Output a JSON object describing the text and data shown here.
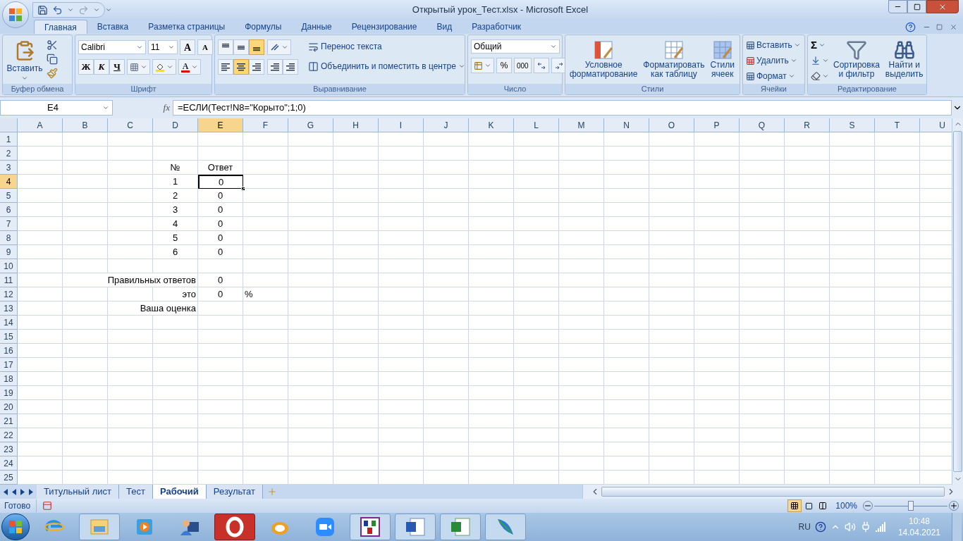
{
  "window": {
    "title": "Открытый урок_Тест.xlsx - Microsoft Excel"
  },
  "ribbon_tabs": [
    {
      "label": "Главная",
      "selected": true
    },
    {
      "label": "Вставка",
      "selected": false
    },
    {
      "label": "Разметка страницы",
      "selected": false
    },
    {
      "label": "Формулы",
      "selected": false
    },
    {
      "label": "Данные",
      "selected": false
    },
    {
      "label": "Рецензирование",
      "selected": false
    },
    {
      "label": "Вид",
      "selected": false
    },
    {
      "label": "Разработчик",
      "selected": false
    }
  ],
  "clipboard": {
    "title": "Буфер обмена",
    "paste": "Вставить"
  },
  "font": {
    "title": "Шрифт",
    "name": "Calibri",
    "size": "11",
    "grow": "A",
    "shrink": "A",
    "bold": "Ж",
    "italic": "К",
    "underline": "Ч",
    "color_letter": "A"
  },
  "alignment": {
    "title": "Выравнивание",
    "vertical": [
      {
        "selected": false
      },
      {
        "selected": false
      },
      {
        "selected": true
      }
    ],
    "horizontal": [
      {
        "selected": false
      },
      {
        "selected": true
      },
      {
        "selected": false
      }
    ],
    "wrap": "Перенос текста",
    "merge": "Объединить и поместить в центре"
  },
  "number": {
    "title": "Число",
    "format": "Общий",
    "percent": "%",
    "thousands": "000"
  },
  "styles": {
    "title": "Стили",
    "buttons": [
      {
        "lines": [
          "Условное",
          "форматирование"
        ]
      },
      {
        "lines": [
          "Форматировать",
          "как таблицу"
        ]
      },
      {
        "lines": [
          "Стили",
          "ячеек"
        ]
      }
    ]
  },
  "cells": {
    "title": "Ячейки",
    "buttons": [
      "Вставить",
      "Удалить",
      "Формат"
    ]
  },
  "editing": {
    "title": "Редактирование",
    "sigma": "Σ",
    "buttons": [
      {
        "lines": [
          "Сортировка",
          "и фильтр"
        ]
      },
      {
        "lines": [
          "Найти и",
          "выделить"
        ]
      }
    ]
  },
  "formula_bar": {
    "name_box": "E4",
    "fx": "fx",
    "formula": "=ЕСЛИ(Тест!N8=\"Корыто\";1;0)"
  },
  "columns": [
    "A",
    "B",
    "C",
    "D",
    "E",
    "F",
    "G",
    "H",
    "I",
    "J",
    "K",
    "L",
    "M",
    "N",
    "O",
    "P",
    "Q",
    "R",
    "S",
    "T",
    "U"
  ],
  "rows": [
    {
      "number": "1",
      "cells": {}
    },
    {
      "number": "2",
      "cells": {}
    },
    {
      "number": "3",
      "cells": {
        "D": {
          "kind": "value",
          "text": "№",
          "selected": false
        },
        "E": {
          "kind": "value",
          "text": "Ответ",
          "selected": false
        }
      }
    },
    {
      "number": "4",
      "cells": {
        "D": {
          "kind": "value",
          "text": "1",
          "selected": false
        },
        "E": {
          "kind": "value",
          "text": "0",
          "selected": true
        }
      }
    },
    {
      "number": "5",
      "cells": {
        "D": {
          "kind": "value",
          "text": "2",
          "selected": false
        },
        "E": {
          "kind": "value",
          "text": "0",
          "selected": false
        }
      }
    },
    {
      "number": "6",
      "cells": {
        "D": {
          "kind": "value",
          "text": "3",
          "selected": false
        },
        "E": {
          "kind": "value",
          "text": "0",
          "selected": false
        }
      }
    },
    {
      "number": "7",
      "cells": {
        "D": {
          "kind": "value",
          "text": "4",
          "selected": false
        },
        "E": {
          "kind": "value",
          "text": "0",
          "selected": false
        }
      }
    },
    {
      "number": "8",
      "cells": {
        "D": {
          "kind": "value",
          "text": "5",
          "selected": false
        },
        "E": {
          "kind": "value",
          "text": "0",
          "selected": false
        }
      }
    },
    {
      "number": "9",
      "cells": {
        "D": {
          "kind": "value",
          "text": "6",
          "selected": false
        },
        "E": {
          "kind": "value",
          "text": "0",
          "selected": false
        }
      }
    },
    {
      "number": "10",
      "cells": {}
    },
    {
      "number": "11",
      "cells": {
        "D": {
          "kind": "label",
          "text": "Правильных ответов",
          "selected": false
        },
        "E": {
          "kind": "value",
          "text": "0",
          "selected": false
        }
      }
    },
    {
      "number": "12",
      "cells": {
        "D": {
          "kind": "label",
          "text": "это",
          "selected": false
        },
        "E": {
          "kind": "value",
          "text": "0",
          "selected": false
        },
        "F": {
          "kind": "unit",
          "text": "%",
          "selected": false
        }
      }
    },
    {
      "number": "13",
      "cells": {
        "D": {
          "kind": "label",
          "text": "Ваша оценка",
          "selected": false
        }
      }
    },
    {
      "number": "14",
      "cells": {}
    },
    {
      "number": "15",
      "cells": {}
    },
    {
      "number": "16",
      "cells": {}
    },
    {
      "number": "17",
      "cells": {}
    },
    {
      "number": "18",
      "cells": {}
    },
    {
      "number": "19",
      "cells": {}
    },
    {
      "number": "20",
      "cells": {}
    },
    {
      "number": "21",
      "cells": {}
    },
    {
      "number": "22",
      "cells": {}
    },
    {
      "number": "23",
      "cells": {}
    },
    {
      "number": "24",
      "cells": {}
    },
    {
      "number": "25",
      "cells": {}
    }
  ],
  "sheet_tabs": [
    {
      "label": "Титульный лист",
      "selected": false
    },
    {
      "label": "Тест",
      "selected": false
    },
    {
      "label": "Рабочий",
      "selected": true
    },
    {
      "label": "Результат",
      "selected": false
    }
  ],
  "status_bar": {
    "status": "Готово",
    "zoom": "100%",
    "zoom_level": {
      "level": 0.5
    }
  },
  "taskbar": {
    "tray": {
      "language": "RU",
      "time": "10:48",
      "date": "14.04.2021"
    }
  }
}
